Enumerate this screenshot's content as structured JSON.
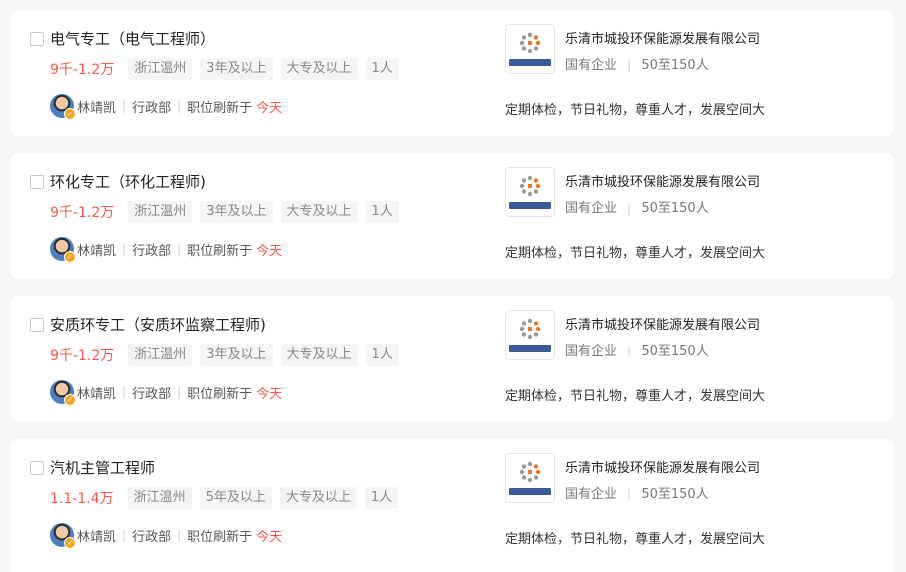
{
  "jobs": [
    {
      "title": "电气专工（电气工程师）",
      "salary": "9千-1.2万",
      "location": "浙江温州",
      "experience": "3年及以上",
      "education": "大专及以上",
      "headcount": "1人",
      "recruiter": "林靖凯",
      "department": "行政部",
      "refresh_label": "职位刷新于",
      "refresh_time": "今天",
      "company": "乐清市城投环保能源发展有限公司",
      "company_type": "国有企业",
      "company_size": "50至150人",
      "benefits": "定期体检，节日礼物，尊重人才，发展空间大"
    },
    {
      "title": "环化专工（环化工程师)",
      "salary": "9千-1.2万",
      "location": "浙江温州",
      "experience": "3年及以上",
      "education": "大专及以上",
      "headcount": "1人",
      "recruiter": "林靖凯",
      "department": "行政部",
      "refresh_label": "职位刷新于",
      "refresh_time": "今天",
      "company": "乐清市城投环保能源发展有限公司",
      "company_type": "国有企业",
      "company_size": "50至150人",
      "benefits": "定期体检，节日礼物，尊重人才，发展空间大"
    },
    {
      "title": "安质环专工（安质环监察工程师)",
      "salary": "9千-1.2万",
      "location": "浙江温州",
      "experience": "3年及以上",
      "education": "大专及以上",
      "headcount": "1人",
      "recruiter": "林靖凯",
      "department": "行政部",
      "refresh_label": "职位刷新于",
      "refresh_time": "今天",
      "company": "乐清市城投环保能源发展有限公司",
      "company_type": "国有企业",
      "company_size": "50至150人",
      "benefits": "定期体检，节日礼物，尊重人才，发展空间大"
    },
    {
      "title": "汽机主管工程师",
      "salary": "1.1-1.4万",
      "location": "浙江温州",
      "experience": "5年及以上",
      "education": "大专及以上",
      "headcount": "1人",
      "recruiter": "林靖凯",
      "department": "行政部",
      "refresh_label": "职位刷新于",
      "refresh_time": "今天",
      "company": "乐清市城投环保能源发展有限公司",
      "company_type": "国有企业",
      "company_size": "50至150人",
      "benefits": "定期体检，节日礼物，尊重人才，发展空间大"
    }
  ],
  "colors": {
    "salary": "#fe574a",
    "highlight": "#fe574a",
    "logo_orange": "#e8792b",
    "logo_gray": "#9a9a9a",
    "logo_banner": "#3a5a99"
  },
  "icons": {
    "checkbox": "checkbox-icon",
    "avatar_badge": "verified-badge-icon"
  }
}
